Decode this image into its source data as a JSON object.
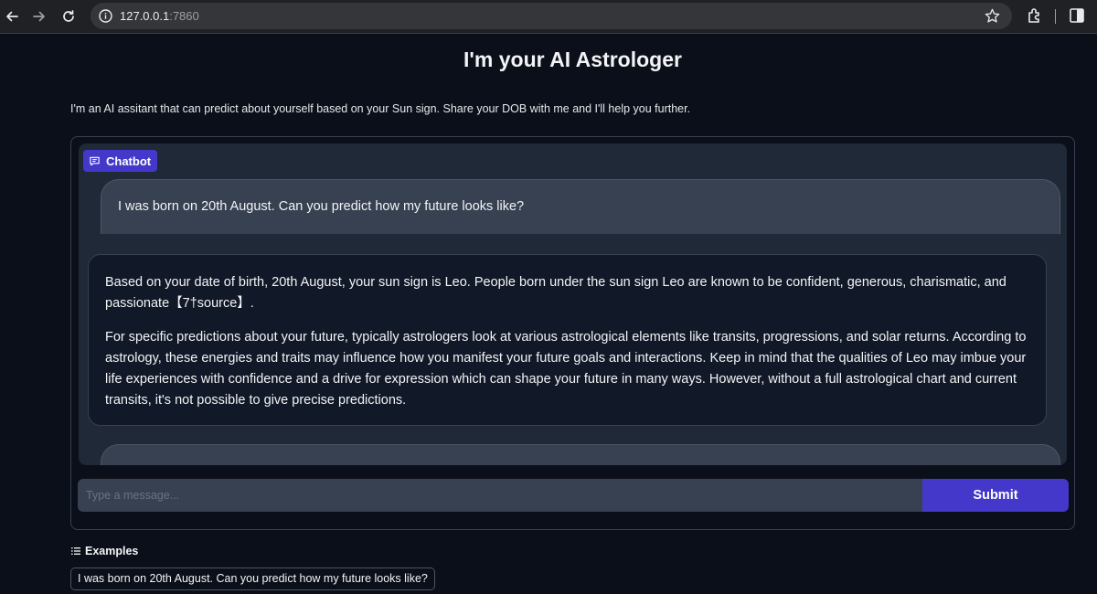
{
  "browser": {
    "url_host": "127.0.0.1",
    "url_port": ":7860",
    "icons": [
      "back-arrow-icon",
      "forward-arrow-icon",
      "reload-icon",
      "info-icon",
      "star-icon",
      "extensions-icon",
      "side-panel-icon"
    ]
  },
  "page": {
    "title": "I'm your AI Astrologer",
    "description": "I'm an AI assitant that can predict about yourself based on your Sun sign. Share your DOB with me and I'll help you further."
  },
  "chatbot": {
    "label": "Chatbot",
    "messages": [
      {
        "role": "user",
        "text": "I was born on 20th August. Can you predict how my future looks like?"
      },
      {
        "role": "assistant",
        "paragraphs": [
          "Based on your date of birth, 20th August, your sun sign is Leo. People born under the sun sign Leo are known to be confident, generous, charismatic, and passionate【7†source】.",
          "For specific predictions about your future, typically astrologers look at various astrological elements like transits, progressions, and solar returns. According to astrology, these energies and traits may influence how you manifest your future goals and interactions. Keep in mind that the qualities of Leo may imbue your life experiences with confidence and a drive for expression which can shape your future in many ways. However, without a full astrological chart and current transits, it's not possible to give precise predictions."
        ]
      }
    ]
  },
  "input": {
    "placeholder": "Type a message...",
    "value": "",
    "submit_label": "Submit"
  },
  "examples": {
    "heading": "Examples",
    "items": [
      "I was born on 20th August. Can you predict how my future looks like?"
    ]
  },
  "colors": {
    "background": "#0b0f19",
    "panel": "#1f2937",
    "accent": "#4338ca"
  }
}
